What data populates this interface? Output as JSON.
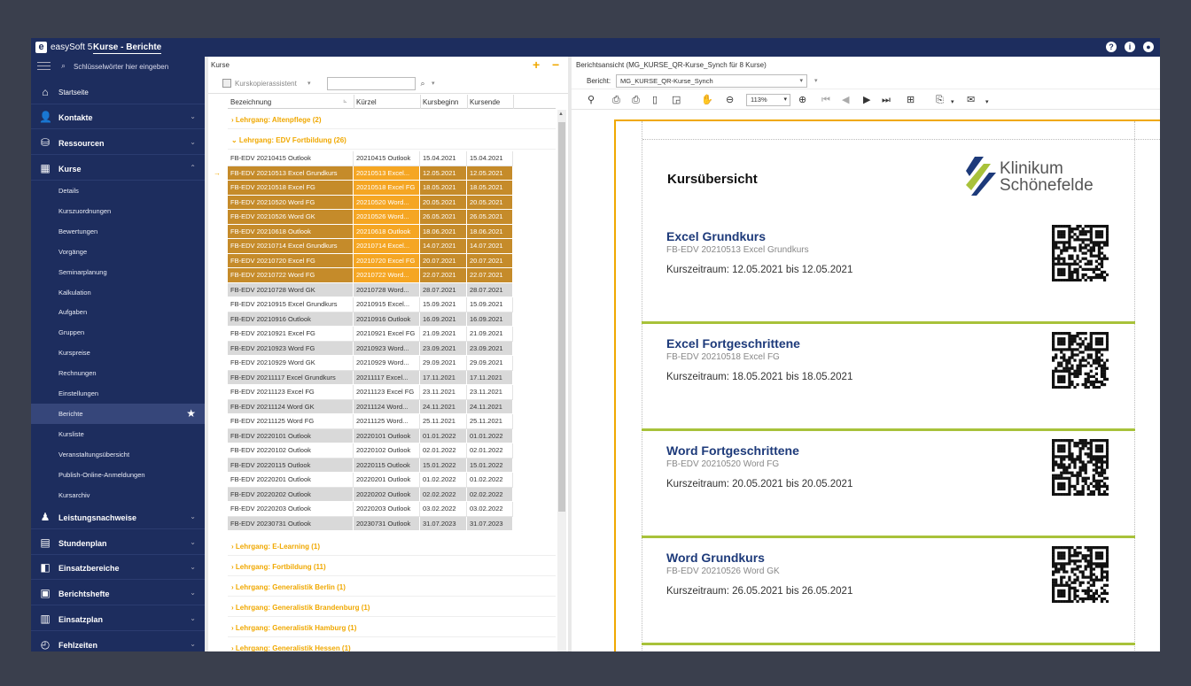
{
  "titlebar": {
    "logo": "e",
    "app_name": "easySoft 5",
    "active_tab": "Kurse - Berichte",
    "icons": [
      "help-icon",
      "info-icon",
      "power-icon"
    ]
  },
  "sidebar": {
    "search_placeholder": "Schlüsselwörter hier eingeben",
    "home": "Startseite",
    "sections_top": [
      {
        "label": "Kontakte",
        "icon": "contacts-icon"
      },
      {
        "label": "Ressourcen",
        "icon": "resources-icon"
      },
      {
        "label": "Kurse",
        "icon": "courses-icon",
        "expanded": true
      }
    ],
    "kurse_items": [
      "Details",
      "Kurszuordnungen",
      "Bewertungen",
      "Vorgänge",
      "Seminarplanung",
      "Kalkulation",
      "Aufgaben",
      "Gruppen",
      "Kurspreise",
      "Rechnungen",
      "Einstellungen",
      "Berichte",
      "Kursliste",
      "Veranstaltungsübersicht",
      "Publish-Online-Anmeldungen",
      "Kursarchiv"
    ],
    "active_item": "Berichte",
    "sections_bottom": [
      {
        "label": "Leistungsnachweise",
        "icon": "certificate-icon"
      },
      {
        "label": "Stundenplan",
        "icon": "timetable-icon"
      },
      {
        "label": "Einsatzbereiche",
        "icon": "areas-icon"
      },
      {
        "label": "Berichtshefte",
        "icon": "report-book-icon"
      },
      {
        "label": "Einsatzplan",
        "icon": "plan-icon"
      },
      {
        "label": "Fehlzeiten",
        "icon": "absence-icon"
      }
    ]
  },
  "kurse": {
    "title": "Kurse",
    "toolbar_assistant": "Kurskopierassistent",
    "columns": [
      "Bezeichnung",
      "Kürzel",
      "Kursbeginn",
      "Kursende"
    ],
    "group_altenpflege": "Lehrgang: Altenpflege (2)",
    "group_edv": "Lehrgang: EDV Fortbildung (26)",
    "rows": [
      {
        "bez": "FB-EDV 20210415 Outlook",
        "kuerzel": "20210415 Outlook",
        "beginn": "15.04.2021",
        "ende": "15.04.2021",
        "state": "plain"
      },
      {
        "bez": "FB-EDV 20210513 Excel Grundkurs",
        "kuerzel": "20210513 Excel...",
        "beginn": "12.05.2021",
        "ende": "12.05.2021",
        "state": "sel"
      },
      {
        "bez": "FB-EDV 20210518 Excel FG",
        "kuerzel": "20210518 Excel FG",
        "beginn": "18.05.2021",
        "ende": "18.05.2021",
        "state": "sel"
      },
      {
        "bez": "FB-EDV 20210520 Word FG",
        "kuerzel": "20210520 Word...",
        "beginn": "20.05.2021",
        "ende": "20.05.2021",
        "state": "sel"
      },
      {
        "bez": "FB-EDV 20210526 Word GK",
        "kuerzel": "20210526 Word...",
        "beginn": "26.05.2021",
        "ende": "26.05.2021",
        "state": "sel"
      },
      {
        "bez": "FB-EDV 20210618 Outlook",
        "kuerzel": "20210618 Outlook",
        "beginn": "18.06.2021",
        "ende": "18.06.2021",
        "state": "sel"
      },
      {
        "bez": "FB-EDV 20210714 Excel Grundkurs",
        "kuerzel": "20210714 Excel...",
        "beginn": "14.07.2021",
        "ende": "14.07.2021",
        "state": "sel"
      },
      {
        "bez": "FB-EDV 20210720 Excel FG",
        "kuerzel": "20210720 Excel FG",
        "beginn": "20.07.2021",
        "ende": "20.07.2021",
        "state": "sel"
      },
      {
        "bez": "FB-EDV 20210722 Word FG",
        "kuerzel": "20210722 Word...",
        "beginn": "22.07.2021",
        "ende": "22.07.2021",
        "state": "sel"
      },
      {
        "bez": "FB-EDV 20210728 Word GK",
        "kuerzel": "20210728 Word...",
        "beginn": "28.07.2021",
        "ende": "28.07.2021",
        "state": "grey"
      },
      {
        "bez": "FB-EDV 20210915 Excel Grundkurs",
        "kuerzel": "20210915 Excel...",
        "beginn": "15.09.2021",
        "ende": "15.09.2021",
        "state": "plain"
      },
      {
        "bez": "FB-EDV 20210916 Outlook",
        "kuerzel": "20210916 Outlook",
        "beginn": "16.09.2021",
        "ende": "16.09.2021",
        "state": "grey"
      },
      {
        "bez": "FB-EDV 20210921 Excel FG",
        "kuerzel": "20210921 Excel FG",
        "beginn": "21.09.2021",
        "ende": "21.09.2021",
        "state": "plain"
      },
      {
        "bez": "FB-EDV 20210923 Word FG",
        "kuerzel": "20210923 Word...",
        "beginn": "23.09.2021",
        "ende": "23.09.2021",
        "state": "grey"
      },
      {
        "bez": "FB-EDV 20210929 Word GK",
        "kuerzel": "20210929 Word...",
        "beginn": "29.09.2021",
        "ende": "29.09.2021",
        "state": "plain"
      },
      {
        "bez": "FB-EDV 20211117 Excel Grundkurs",
        "kuerzel": "20211117 Excel...",
        "beginn": "17.11.2021",
        "ende": "17.11.2021",
        "state": "grey"
      },
      {
        "bez": "FB-EDV 20211123 Excel FG",
        "kuerzel": "20211123 Excel FG",
        "beginn": "23.11.2021",
        "ende": "23.11.2021",
        "state": "plain"
      },
      {
        "bez": "FB-EDV 20211124 Word GK",
        "kuerzel": "20211124 Word...",
        "beginn": "24.11.2021",
        "ende": "24.11.2021",
        "state": "grey"
      },
      {
        "bez": "FB-EDV 20211125 Word FG",
        "kuerzel": "20211125 Word...",
        "beginn": "25.11.2021",
        "ende": "25.11.2021",
        "state": "plain"
      },
      {
        "bez": "FB-EDV 20220101 Outlook",
        "kuerzel": "20220101 Outlook",
        "beginn": "01.01.2022",
        "ende": "01.01.2022",
        "state": "grey"
      },
      {
        "bez": "FB-EDV 20220102 Outlook",
        "kuerzel": "20220102 Outlook",
        "beginn": "02.01.2022",
        "ende": "02.01.2022",
        "state": "plain"
      },
      {
        "bez": "FB-EDV 20220115 Outlook",
        "kuerzel": "20220115 Outlook",
        "beginn": "15.01.2022",
        "ende": "15.01.2022",
        "state": "grey"
      },
      {
        "bez": "FB-EDV 20220201 Outlook",
        "kuerzel": "20220201 Outlook",
        "beginn": "01.02.2022",
        "ende": "01.02.2022",
        "state": "plain"
      },
      {
        "bez": "FB-EDV 20220202 Outlook",
        "kuerzel": "20220202 Outlook",
        "beginn": "02.02.2022",
        "ende": "02.02.2022",
        "state": "grey"
      },
      {
        "bez": "FB-EDV 20220203 Outlook",
        "kuerzel": "20220203 Outlook",
        "beginn": "03.02.2022",
        "ende": "03.02.2022",
        "state": "plain"
      },
      {
        "bez": "FB-EDV 20230731 Outlook",
        "kuerzel": "20230731 Outlook",
        "beginn": "31.07.2023",
        "ende": "31.07.2023",
        "state": "grey"
      }
    ],
    "groups_after": [
      "Lehrgang: E-Learning (1)",
      "Lehrgang: Fortbildung (11)",
      "Lehrgang: Generalistik Berlin (1)",
      "Lehrgang: Generalistik Brandenburg (1)",
      "Lehrgang: Generalistik Hamburg (1)",
      "Lehrgang: Generalistik Hessen (1)"
    ]
  },
  "report": {
    "title": "Berichtsansicht (MG_KURSE_QR-Kurse_Synch für 8 Kurse)",
    "bericht_label": "Bericht:",
    "bericht_value": "MG_KURSE_QR-Kurse_Synch",
    "zoom": "113%",
    "heading": "Kursübersicht",
    "brand_line1": "Klinikum",
    "brand_line2": "Schönefelde",
    "courses": [
      {
        "title": "Excel Grundkurs",
        "sub": "FB-EDV 20210513 Excel Grundkurs",
        "zeit": "Kurszeitraum: 12.05.2021  bis  12.05.2021"
      },
      {
        "title": "Excel Fortgeschrittene",
        "sub": "FB-EDV 20210518 Excel FG",
        "zeit": "Kurszeitraum: 18.05.2021  bis  18.05.2021"
      },
      {
        "title": "Word Fortgeschrittene",
        "sub": "FB-EDV 20210520 Word FG",
        "zeit": "Kurszeitraum: 20.05.2021  bis  20.05.2021"
      },
      {
        "title": "Word Grundkurs",
        "sub": "FB-EDV 20210526 Word GK",
        "zeit": "Kurszeitraum: 26.05.2021  bis  26.05.2021"
      }
    ]
  },
  "colors": {
    "navy": "#1d2d5e",
    "accent": "#f0a800",
    "selected_row": "#c58b2a",
    "green_rule": "#a8c23a",
    "course_title": "#1d3a7a"
  }
}
